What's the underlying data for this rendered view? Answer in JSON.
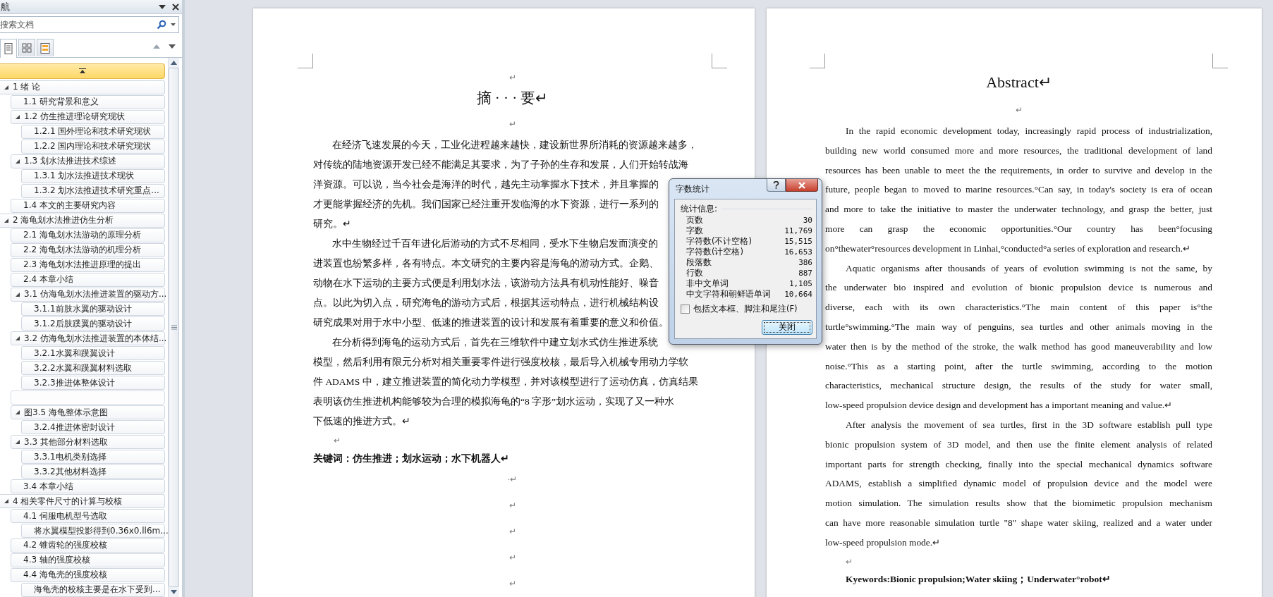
{
  "navigation": {
    "title": "航",
    "search": {
      "placeholder": "搜索文档"
    },
    "tabs": [
      {
        "kind": "headings",
        "selected": true
      },
      {
        "kind": "thumbnails",
        "selected": false
      },
      {
        "kind": "results",
        "selected": false
      }
    ],
    "outline": [
      {
        "label": "1 绪  论",
        "expanded": true,
        "children": [
          {
            "label": "1.1 研究背景和意义"
          },
          {
            "label": "1.2 仿生推进理论研究现状",
            "expanded": true,
            "children": [
              {
                "label": "1.2.1 国外理论和技术研究现状"
              },
              {
                "label": "1.2.2 国内理论和技术研究现状"
              }
            ]
          },
          {
            "label": "1.3 划水法推进技术综述",
            "expanded": true,
            "children": [
              {
                "label": "1.3.1 划水法推进技术现状"
              },
              {
                "label": "1.3.2 划水法推进技术研究重点..."
              }
            ]
          },
          {
            "label": "1.4 本文的主要研究内容"
          }
        ]
      },
      {
        "label": "2 海龟划水法推进仿生分析",
        "expanded": true,
        "children": [
          {
            "label": "2.1 海龟划水法游动的原理分析"
          },
          {
            "label": "2.2 海龟划水法游动的机理分析"
          },
          {
            "label": "2.3 海龟划水法推进原理的提出"
          },
          {
            "label": "2.4 本章小结"
          },
          {
            "label": "3.1 仿海龟划水法推进装置的驱动方...",
            "expanded": true,
            "children": [
              {
                "label": "3.1.1前肢水翼的驱动设计"
              },
              {
                "label": "3.1.2后肢蹼翼的驱动设计"
              }
            ]
          },
          {
            "label": "3.2 仿海龟划水法推进装置的本体结...",
            "expanded": true,
            "children": [
              {
                "label": "3.2.1水翼和蹼翼设计"
              },
              {
                "label": "3.2.2水翼和蹼翼材料选取"
              },
              {
                "label": "3.2.3推进体整体设计"
              }
            ]
          },
          {
            "kind": "blank"
          },
          {
            "label": "图3.5  海龟整体示意图",
            "expanded": true,
            "children": [
              {
                "label": "3.2.4推进体密封设计"
              }
            ]
          },
          {
            "label": "3.3 其他部分材料选取",
            "expanded": true,
            "children": [
              {
                "label": "3.3.1电机类别选择"
              },
              {
                "label": "3.3.2其他材料选择"
              }
            ]
          },
          {
            "label": "3.4 本章小结"
          }
        ]
      },
      {
        "label": "4 相关零件尺寸的计算与校核",
        "expanded": true,
        "children": [
          {
            "label": "4.1 伺服电机型号选取",
            "children": [
              {
                "label": "将水翼模型投影得到0.36x0.ll6m..."
              }
            ]
          },
          {
            "label": "4.2 锥齿轮的强度校核"
          },
          {
            "label": "4.3 轴的强度校核"
          },
          {
            "label": "4.4 海龟壳的强度校核",
            "children": [
              {
                "label": "海龟壳的校核主要是在水下受到..."
              }
            ]
          }
        ]
      }
    ]
  },
  "pages": [
    {
      "kind": "chinese",
      "blocks": [
        {
          "kind": "mark",
          "text": "↵"
        },
        {
          "kind": "title",
          "text": "摘 · · · 要↵"
        },
        {
          "kind": "mark",
          "text": "↵"
        },
        {
          "kind": "paragraph",
          "lines": [
            "在经济飞速发展的今天，工业化进程越来越快，建设新世界所消耗的资源越来越多，",
            "对传统的陆地资源开发已经不能满足其要求，为了子孙的生存和发展，人们开始转战海",
            "洋资源。可以说，当今社会是海洋的时代，越先主动掌握水下技术，并且掌握的",
            "才更能掌握经济的先机。我们国家已经注重开发临海的水下资源，进行一系列的",
            "研究。↵"
          ]
        },
        {
          "kind": "paragraph",
          "lines": [
            "水中生物经过千百年进化后游动的方式不尽相同，受水下生物启发而演变的",
            "进装置也纷繁多样，各有特点。本文研究的主要内容是海龟的游动方式。企鹅、",
            "动物在水下运动的主要方式便是利用划水法，该游动方法具有机动性能好、噪音",
            "点。以此为切入点，研究海龟的游动方式后，根据其运动特点，进行机械结构设",
            "研究成果对用于水中小型、低速的推进装置的设计和发展有着重要的意义和价值。"
          ]
        },
        {
          "kind": "paragraph",
          "lines": [
            "在分析得到海龟的运动方式后，首先在三维软件中建立划水式仿生推进系统",
            "模型，然后利用有限元分析对相关重要零件进行强度校核，最后导入机械专用动力学软",
            "件 ADAMS 中，建立推进装置的简化动力学模型，并对该模型进行了运动仿真，仿真结果",
            "表明该仿生推进机构能够较为合理的模拟海龟的“8 字形”划水运动，实现了又一种水",
            "下低速的推进方式。↵"
          ]
        },
        {
          "kind": "indent_mark",
          "text": "↵"
        },
        {
          "kind": "keywords",
          "text": "关键词：仿生推进；划水运动；水下机器人↵"
        },
        {
          "kind": "tail_mark",
          "text": "·↵"
        },
        {
          "kind": "tail_mark",
          "text": "↵"
        },
        {
          "kind": "tail_mark",
          "text": "↵"
        },
        {
          "kind": "tail_mark",
          "text": "↵"
        },
        {
          "kind": "tail_mark",
          "text": "↵"
        }
      ]
    },
    {
      "kind": "english",
      "blocks": [
        {
          "kind": "title",
          "text": "Abstract↵"
        },
        {
          "kind": "mark",
          "text": "↵"
        },
        {
          "kind": "paragraph",
          "lines": [
            "In the rapid economic development today, increasingly rapid process of industrialization,",
            "building new world consumed more and more resources, the traditional development of land",
            "resources has been unable to meet the the requirements, in order to survive and develop in the",
            "future, people began to moved to marine resources.°Can say, in today's society is era of ocean",
            "and more to take the initiative to master the underwater technology, and grasp the better, just",
            "more can grasp the economic opportunities.°Our country has been°focusing",
            "on°thewater°resources development in Linhai,°conducted°a series of exploration and research.↵"
          ]
        },
        {
          "kind": "paragraph",
          "lines": [
            "Aquatic organisms after thousands of years of evolution swimming is not the same, by",
            "the underwater bio inspired and evolution of bionic propulsion device is numerous and",
            "diverse, each with its own characteristics.°The main content of this paper is°the",
            "turtle°swimming.°The main way of penguins, sea turtles and other animals moving in the",
            "water then is by the method of the stroke, the walk method has good maneuverability and low",
            "noise.°This as a starting point, after the turtle swimming, according to the motion",
            "characteristics, mechanical structure design, the results of the study for water small,",
            "low-speed propulsion device design and development has a important meaning and value.↵"
          ]
        },
        {
          "kind": "paragraph",
          "lines": [
            "After analysis the movement of sea turtles, first in the 3D software establish pull type",
            "bionic propulsion system of 3D model, and then use the finite element analysis of related",
            "important parts for strength checking, finally into the special mechanical dynamics software",
            "ADAMS, establish a simplified dynamic model of propulsion device and the model were",
            "motion simulation. The simulation results show that the biomimetic propulsion mechanism",
            "can have more reasonable simulation turtle \"8\" shape water skiing, realized and a water under",
            "low-speed propulsion mode.↵"
          ]
        },
        {
          "kind": "indent_mark",
          "text": "↵"
        },
        {
          "kind": "keywords",
          "text": "Kyewords:Bionic propulsion;Water skiing；Underwater°robot↵"
        }
      ]
    }
  ],
  "dialog": {
    "title": "字数统计",
    "section": "统计信息:",
    "stats": [
      {
        "label": "页数",
        "value": "30"
      },
      {
        "label": "字数",
        "value": "11,769"
      },
      {
        "label": "字符数(不计空格)",
        "value": "15,515"
      },
      {
        "label": "字符数(计空格)",
        "value": "16,653"
      },
      {
        "label": "段落数",
        "value": "386"
      },
      {
        "label": "行数",
        "value": "887"
      },
      {
        "label": "非中文单词",
        "value": "1,105"
      },
      {
        "label": "中文字符和朝鲜语单词",
        "value": "10,664"
      }
    ],
    "checkbox": {
      "label": "包括文本框、脚注和尾注(F)",
      "checked": false
    },
    "button": "关闭"
  }
}
